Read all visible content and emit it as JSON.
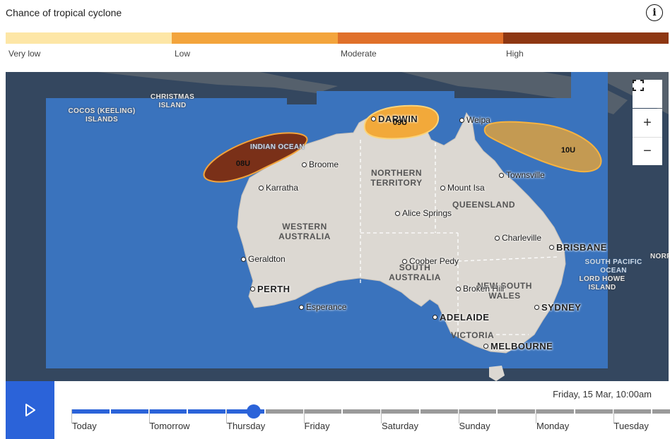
{
  "header": {
    "title": "Chance of tropical cyclone",
    "info_icon": "info-icon"
  },
  "legend": {
    "items": [
      {
        "label": "Very low",
        "color": "#fde6a6"
      },
      {
        "label": "Low",
        "color": "#f3a43c"
      },
      {
        "label": "Moderate",
        "color": "#e0702a"
      },
      {
        "label": "High",
        "color": "#8e3712"
      }
    ]
  },
  "map": {
    "controls": {
      "fullscreen": "fullscreen-icon",
      "zoom_in": "+",
      "zoom_out": "−"
    },
    "regions": [
      "WESTERN AUSTRALIA",
      "NORTHERN TERRITORY",
      "QUEENSLAND",
      "SOUTH AUSTRALIA",
      "NEW SOUTH WALES",
      "VICTORIA"
    ],
    "oceans": [
      "INDIAN OCEAN",
      "SOUTH PACIFIC OCEAN"
    ],
    "islands": [
      "CHRISTMAS ISLAND",
      "COCOS (KEELING) ISLANDS",
      "LORD HOWE ISLAND",
      "NORFOLK"
    ],
    "cities": [
      "Broome",
      "Karratha",
      "Geraldton",
      "PERTH",
      "Esperance",
      "DARWIN",
      "Weipa",
      "Townsville",
      "Mount Isa",
      "Alice Springs",
      "Charleville",
      "BRISBANE",
      "Coober Pedy",
      "Broken Hill",
      "ADELAIDE",
      "SYDNEY",
      "MELBOURNE"
    ],
    "storms": [
      {
        "id": "08U",
        "chance": "High",
        "color": "#7a3018"
      },
      {
        "id": "09U",
        "chance": "Low",
        "color": "#f2a93a"
      },
      {
        "id": "10U",
        "chance": "Low",
        "color": "#c49a52"
      }
    ]
  },
  "timeline": {
    "current": "Friday, 15 Mar, 10:00am",
    "days": [
      "Today",
      "Tomorrow",
      "Thursday",
      "Friday",
      "Saturday",
      "Sunday",
      "Monday",
      "Tuesday"
    ],
    "progress_fraction": 0.295,
    "play_icon": "play-icon"
  }
}
